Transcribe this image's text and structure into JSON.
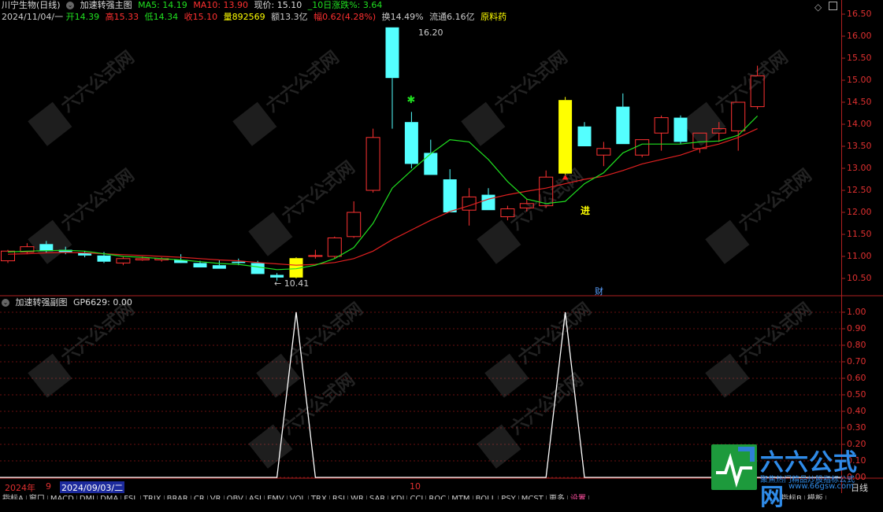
{
  "main_header": {
    "stock_name": "川宁生物(日线)",
    "indicator_name": "加速转强主图",
    "ma5": "MA5: 14.19",
    "ma10": "MA10: 13.90",
    "price_now": "现价: 15.10",
    "change10": "_10日涨跌%: 3.64"
  },
  "quote_line": {
    "date": "2024/11/04/一",
    "open": "开14.39",
    "high": "高15.33",
    "low": "低14.34",
    "close": "收15.10",
    "volume": "量892569",
    "amount": "额13.3亿",
    "amplitude": "幅0.62(4.28%)",
    "turnover": "换14.49%",
    "float_cap": "流通6.16亿",
    "sector": "原料药"
  },
  "annotations": {
    "high_label": "16.20",
    "low_label": "← 10.41",
    "enter_label": "进",
    "finance_label": "财"
  },
  "price_axis": [
    "16.50",
    "16.00",
    "15.50",
    "15.00",
    "14.50",
    "14.00",
    "13.50",
    "13.00",
    "12.50",
    "12.00",
    "11.50",
    "11.00",
    "10.50"
  ],
  "sub_header": {
    "name": "加速转强副图",
    "value": "GP6629: 0.00"
  },
  "sub_axis": [
    "1.00",
    "0.90",
    "0.80",
    "0.70",
    "0.60",
    "0.50",
    "0.40",
    "0.30",
    "0.20",
    "0.10",
    "0.00"
  ],
  "time_axis": {
    "year": "2024年",
    "month9": "9",
    "selected_date": "2024/09/03/二",
    "month10": "10",
    "period": "日线"
  },
  "bottom_tabs": [
    "指标A",
    "窗口",
    "MACD",
    "DMI",
    "DMA",
    "FSL",
    "TRIX",
    "BRAR",
    "CR",
    "VR",
    "OBV",
    "ASI",
    "EMV",
    "VOL",
    "TRX",
    "RSI",
    "WR",
    "SAR",
    "KDJ",
    "CCI",
    "ROC",
    "MTM",
    "BOLL",
    "PSY",
    "MCST",
    "更多",
    "设置"
  ],
  "bottom_right_tabs": [
    "指标B",
    "模板"
  ],
  "watermark": {
    "brand": "六六公式网",
    "slogan": "聚焦热门精品炒股指标公式",
    "url": "www.66gsw.com"
  },
  "colors": {
    "up": "#ff3232",
    "down": "#54ffff",
    "signal": "#ffff00",
    "ma_fast": "#20e020",
    "ma_slow": "#e02020"
  },
  "chart_data": {
    "type": "candlestick",
    "ohlc": [
      [
        10.9,
        11.15,
        10.85,
        11.12
      ],
      [
        11.1,
        11.3,
        11.05,
        11.22
      ],
      [
        11.28,
        11.35,
        11.08,
        11.12
      ],
      [
        11.15,
        11.22,
        11.05,
        11.1
      ],
      [
        11.08,
        11.12,
        10.98,
        11.02
      ],
      [
        11.02,
        11.1,
        10.85,
        10.88
      ],
      [
        10.85,
        11.0,
        10.8,
        10.95
      ],
      [
        10.92,
        11.0,
        10.9,
        10.95
      ],
      [
        10.92,
        10.98,
        10.88,
        10.95
      ],
      [
        10.92,
        11.05,
        10.86,
        10.85
      ],
      [
        10.85,
        10.9,
        10.75,
        10.75
      ],
      [
        10.8,
        10.92,
        10.72,
        10.72
      ],
      [
        10.88,
        10.95,
        10.8,
        10.85
      ],
      [
        10.85,
        10.9,
        10.6,
        10.6
      ],
      [
        10.58,
        10.62,
        10.45,
        10.52
      ],
      [
        10.52,
        10.98,
        10.5,
        10.96
      ],
      [
        11.0,
        11.15,
        10.95,
        11.02
      ],
      [
        11.0,
        11.45,
        10.95,
        11.42
      ],
      [
        11.45,
        12.25,
        11.42,
        12.0
      ],
      [
        12.5,
        13.9,
        12.45,
        13.7
      ],
      [
        16.2,
        16.2,
        13.9,
        15.05
      ],
      [
        14.05,
        14.28,
        13.0,
        13.1
      ],
      [
        13.35,
        13.65,
        12.85,
        12.85
      ],
      [
        12.75,
        12.98,
        12.0,
        12.0
      ],
      [
        12.05,
        12.55,
        11.7,
        12.35
      ],
      [
        12.4,
        12.55,
        12.05,
        12.05
      ],
      [
        11.9,
        12.15,
        11.82,
        12.08
      ],
      [
        12.1,
        12.3,
        12.02,
        12.2
      ],
      [
        12.15,
        12.95,
        12.1,
        12.8
      ],
      [
        12.88,
        14.62,
        12.85,
        14.55
      ],
      [
        13.95,
        14.05,
        13.5,
        13.5
      ],
      [
        13.3,
        13.6,
        13.05,
        13.45
      ],
      [
        14.4,
        14.7,
        13.55,
        13.55
      ],
      [
        13.3,
        13.65,
        13.25,
        13.65
      ],
      [
        13.8,
        14.2,
        13.4,
        14.15
      ],
      [
        14.15,
        14.2,
        13.55,
        13.6
      ],
      [
        13.45,
        13.8,
        13.35,
        13.8
      ],
      [
        13.8,
        14.05,
        13.6,
        13.9
      ],
      [
        13.85,
        14.5,
        13.4,
        14.5
      ],
      [
        14.4,
        15.33,
        14.34,
        15.1
      ]
    ],
    "ma5": [
      11.1,
      11.12,
      11.13,
      11.14,
      11.12,
      11.06,
      11.0,
      10.98,
      10.95,
      10.92,
      10.88,
      10.84,
      10.82,
      10.76,
      10.7,
      10.72,
      10.8,
      10.95,
      11.2,
      11.75,
      12.55,
      12.95,
      13.33,
      13.65,
      13.6,
      13.2,
      12.7,
      12.3,
      12.2,
      12.25,
      12.65,
      12.9,
      13.35,
      13.55,
      13.55,
      13.55,
      13.6,
      13.62,
      13.75,
      14.19
    ],
    "ma10": [
      11.05,
      11.06,
      11.08,
      11.09,
      11.08,
      11.06,
      11.04,
      11.02,
      11.0,
      10.98,
      10.95,
      10.92,
      10.9,
      10.86,
      10.83,
      10.8,
      10.82,
      10.86,
      10.95,
      11.12,
      11.38,
      11.6,
      11.82,
      12.02,
      12.15,
      12.3,
      12.4,
      12.48,
      12.55,
      12.65,
      12.75,
      12.82,
      12.95,
      13.1,
      13.2,
      13.3,
      13.45,
      13.55,
      13.7,
      13.9
    ],
    "signal_bars": [
      15,
      29
    ],
    "sub_series": {
      "name": "GP6629",
      "x_peaks": [
        15,
        29
      ],
      "values_at_peaks": 1.0,
      "baseline": 0.0
    },
    "ylim": [
      10.2,
      16.6
    ],
    "sub_ylim": [
      0,
      1
    ]
  }
}
